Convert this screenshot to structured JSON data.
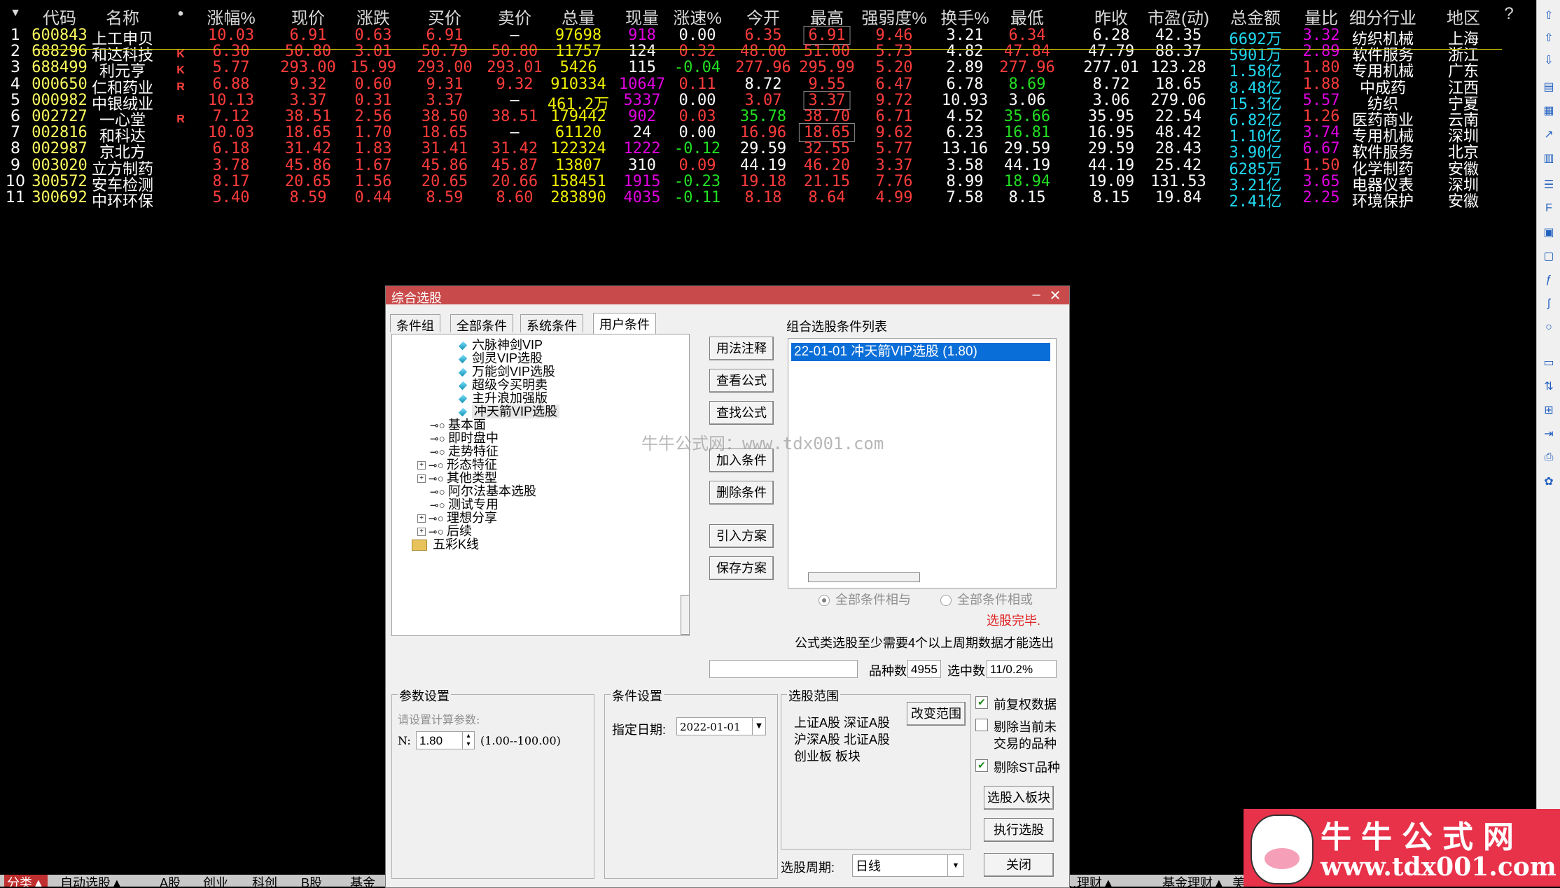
{
  "table": {
    "headers": [
      "代码",
      "名称",
      "•",
      "涨幅%",
      "现价",
      "涨跌",
      "买价",
      "卖价",
      "总量",
      "现量",
      "涨速%",
      "今开",
      "最高",
      "强弱度%",
      "换手%",
      "最低",
      "昨收",
      "市盈(动)",
      "总金额",
      "量比",
      "细分行业",
      "地区",
      "?"
    ],
    "sort_icon": "sort-down-icon",
    "rows": [
      {
        "idx": "1",
        "code": "600843",
        "name": "上工申贝",
        "flag": "",
        "chg": "10.03",
        "price": "6.91",
        "diff": "0.63",
        "bid": "6.91",
        "ask": "–",
        "vol": "97698",
        "cur": "918",
        "spd": "0.00",
        "open": "6.35",
        "high": "6.91",
        "strength": "9.46",
        "turnover": "3.21",
        "low": "6.34",
        "prev": "6.28",
        "pe": "42.35",
        "amount": "6692万",
        "ratio": "3.32",
        "industry": "纺织机械",
        "region": "上海"
      },
      {
        "idx": "2",
        "code": "688296",
        "name": "和达科技",
        "flag": "K",
        "chg": "6.30",
        "price": "50.80",
        "diff": "3.01",
        "bid": "50.79",
        "ask": "50.80",
        "vol": "11757",
        "cur": "124",
        "spd": "0.32",
        "open": "48.00",
        "high": "51.00",
        "strength": "5.73",
        "turnover": "4.82",
        "low": "47.84",
        "prev": "47.79",
        "pe": "88.37",
        "amount": "5901万",
        "ratio": "2.89",
        "industry": "软件服务",
        "region": "浙江"
      },
      {
        "idx": "3",
        "code": "688499",
        "name": "利元亨",
        "flag": "K",
        "chg": "5.77",
        "price": "293.00",
        "diff": "15.99",
        "bid": "293.00",
        "ask": "293.01",
        "vol": "5426",
        "cur": "115",
        "spd": "-0.04",
        "open": "277.96",
        "high": "295.99",
        "strength": "5.20",
        "turnover": "2.89",
        "low": "277.96",
        "prev": "277.01",
        "pe": "123.28",
        "amount": "1.58亿",
        "ratio": "1.80",
        "industry": "专用机械",
        "region": "广东"
      },
      {
        "idx": "4",
        "code": "000650",
        "name": "仁和药业",
        "flag": "R",
        "chg": "6.88",
        "price": "9.32",
        "diff": "0.60",
        "bid": "9.31",
        "ask": "9.32",
        "vol": "910334",
        "cur": "10647",
        "spd": "0.11",
        "open": "8.72",
        "high": "9.55",
        "strength": "6.47",
        "turnover": "6.78",
        "low": "8.69",
        "prev": "8.72",
        "pe": "18.65",
        "amount": "8.48亿",
        "ratio": "1.88",
        "industry": "中成药",
        "region": "江西"
      },
      {
        "idx": "5",
        "code": "000982",
        "name": "中银绒业",
        "flag": "",
        "chg": "10.13",
        "price": "3.37",
        "diff": "0.31",
        "bid": "3.37",
        "ask": "–",
        "vol": "461.2万",
        "cur": "5337",
        "spd": "0.00",
        "open": "3.07",
        "high": "3.37",
        "strength": "9.72",
        "turnover": "10.93",
        "low": "3.06",
        "prev": "3.06",
        "pe": "279.06",
        "amount": "15.3亿",
        "ratio": "5.57",
        "industry": "纺织",
        "region": "宁夏"
      },
      {
        "idx": "6",
        "code": "002727",
        "name": "一心堂",
        "flag": "R",
        "chg": "7.12",
        "price": "38.51",
        "diff": "2.56",
        "bid": "38.50",
        "ask": "38.51",
        "vol": "179442",
        "cur": "902",
        "spd": "0.03",
        "open": "35.78",
        "high": "38.70",
        "strength": "6.71",
        "turnover": "4.52",
        "low": "35.66",
        "prev": "35.95",
        "pe": "22.54",
        "amount": "6.82亿",
        "ratio": "1.26",
        "industry": "医药商业",
        "region": "云南"
      },
      {
        "idx": "7",
        "code": "002816",
        "name": "和科达",
        "flag": "",
        "chg": "10.03",
        "price": "18.65",
        "diff": "1.70",
        "bid": "18.65",
        "ask": "–",
        "vol": "61120",
        "cur": "24",
        "spd": "0.00",
        "open": "16.96",
        "high": "18.65",
        "strength": "9.62",
        "turnover": "6.23",
        "low": "16.81",
        "prev": "16.95",
        "pe": "48.42",
        "amount": "1.10亿",
        "ratio": "3.74",
        "industry": "专用机械",
        "region": "深圳"
      },
      {
        "idx": "8",
        "code": "002987",
        "name": "京北方",
        "flag": "",
        "chg": "6.18",
        "price": "31.42",
        "diff": "1.83",
        "bid": "31.41",
        "ask": "31.42",
        "vol": "122324",
        "cur": "1222",
        "spd": "-0.12",
        "open": "29.59",
        "high": "32.55",
        "strength": "5.77",
        "turnover": "13.16",
        "low": "29.59",
        "prev": "29.59",
        "pe": "28.43",
        "amount": "3.90亿",
        "ratio": "6.67",
        "industry": "软件服务",
        "region": "北京"
      },
      {
        "idx": "9",
        "code": "003020",
        "name": "立方制药",
        "flag": "",
        "chg": "3.78",
        "price": "45.86",
        "diff": "1.67",
        "bid": "45.86",
        "ask": "45.87",
        "vol": "13807",
        "cur": "310",
        "spd": "0.09",
        "open": "44.19",
        "high": "46.20",
        "strength": "3.37",
        "turnover": "3.58",
        "low": "44.19",
        "prev": "44.19",
        "pe": "25.42",
        "amount": "6285万",
        "ratio": "1.50",
        "industry": "化学制药",
        "region": "安徽"
      },
      {
        "idx": "10",
        "code": "300572",
        "name": "安车检测",
        "flag": "",
        "chg": "8.17",
        "price": "20.65",
        "diff": "1.56",
        "bid": "20.65",
        "ask": "20.66",
        "vol": "158451",
        "cur": "1915",
        "spd": "-0.23",
        "open": "19.18",
        "high": "21.15",
        "strength": "7.76",
        "turnover": "8.99",
        "low": "18.94",
        "prev": "19.09",
        "pe": "131.53",
        "amount": "3.21亿",
        "ratio": "3.65",
        "industry": "电器仪表",
        "region": "深圳"
      },
      {
        "idx": "11",
        "code": "300692",
        "name": "中环环保",
        "flag": "",
        "chg": "5.40",
        "price": "8.59",
        "diff": "0.44",
        "bid": "8.59",
        "ask": "8.60",
        "vol": "283890",
        "cur": "4035",
        "spd": "-0.11",
        "open": "8.18",
        "high": "8.64",
        "strength": "4.99",
        "turnover": "7.58",
        "low": "8.15",
        "prev": "8.15",
        "pe": "19.84",
        "amount": "2.41亿",
        "ratio": "2.25",
        "industry": "环境保护",
        "region": "安徽"
      }
    ]
  },
  "colors": {
    "up": "#ff3c3c",
    "down": "#22e022",
    "flat": "#ffffff",
    "volume": "#f0f000",
    "cur_vol": "#e000e0",
    "amount": "#20d8f0",
    "dialog_title": "#c94a4a",
    "selected": "#0a6ed8"
  },
  "bottom_tabs": [
    "分类▲",
    "自动选股▲",
    "A股",
    "创业",
    "科创",
    "B股",
    "基金",
    "…理财▲",
    "基金理财▲",
    "美股/港股▲",
    "…"
  ],
  "dialog": {
    "title": "综合选股",
    "tabs": [
      "条件组",
      "全部条件",
      "系统条件",
      "用户条件"
    ],
    "tree": [
      {
        "label": "六脉神剑VIP",
        "type": "gem"
      },
      {
        "label": "剑灵VIP选股",
        "type": "gem"
      },
      {
        "label": "万能剑VIP选股",
        "type": "gem"
      },
      {
        "label": "超级今买明卖",
        "type": "gem"
      },
      {
        "label": "主升浪加强版",
        "type": "gem"
      },
      {
        "label": "冲天箭VIP选股",
        "type": "gem"
      },
      {
        "label": "基本面",
        "type": "key"
      },
      {
        "label": "即时盘中",
        "type": "key"
      },
      {
        "label": "走势特征",
        "type": "key"
      },
      {
        "label": "形态特征",
        "type": "key-plus"
      },
      {
        "label": "其他类型",
        "type": "key-plus"
      },
      {
        "label": "阿尔法基本选股",
        "type": "key"
      },
      {
        "label": "测试专用",
        "type": "key"
      },
      {
        "label": "理想分享",
        "type": "key-plus"
      },
      {
        "label": "后续",
        "type": "key-plus"
      },
      {
        "label": "五彩K线",
        "type": "folder"
      }
    ],
    "buttons": {
      "usage": "用法注释",
      "view_formula": "查看公式",
      "find_formula": "查找公式",
      "add_cond": "加入条件",
      "del_cond": "删除条件",
      "import_plan": "引入方案",
      "save_plan": "保存方案",
      "change_range": "改变范围",
      "to_block": "选股入板块",
      "execute": "执行选股",
      "close": "关闭"
    },
    "list_title": "组合选股条件列表",
    "list_items": [
      "22-01-01 冲天箭VIP选股 (1.80)"
    ],
    "radio_and": "全部条件相与",
    "radio_or": "全部条件相或",
    "status": "选股完毕.",
    "note": "公式类选股至少需要4个以上周期数据才能选出",
    "count_label": "品种数",
    "count_value": "4955",
    "selected_label": "选中数",
    "selected_value": "11/0.2%",
    "param_group": "参数设置",
    "param_hint": "请设置计算参数:",
    "param_name": "N:",
    "param_value": "1.80",
    "param_range": "(1.00--100.00)",
    "cond_group": "条件设置",
    "date_label": "指定日期:",
    "date_value": "2022-01-01",
    "range_group": "选股范围",
    "range_text_1": "上证A股 深证A股",
    "range_text_2": "沪深A股 北证A股",
    "range_text_3": "创业板 板块",
    "chk_restore": "前复权数据",
    "chk_untraded_1": "剔除当前未",
    "chk_untraded_2": "交易的品种",
    "chk_st": "剔除ST品种",
    "period_label": "选股周期:",
    "period_value": "日线",
    "watermark": "牛牛公式网：www.tdx001.com"
  },
  "logo": {
    "title": "牛牛公式网",
    "url": "www.tdx001.com"
  }
}
